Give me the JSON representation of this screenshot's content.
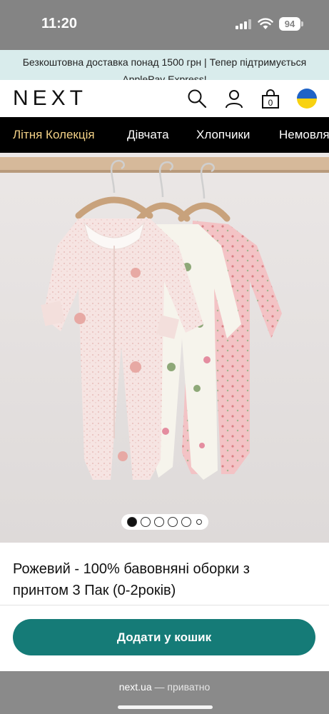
{
  "status_bar": {
    "time": "11:20",
    "battery": "94"
  },
  "promo": {
    "text": "Безкоштовна доставка понад 1500 грн | Тепер підтримується ApplePay Express!"
  },
  "header": {
    "logo": "NEXT",
    "icons": [
      "search-icon",
      "account-icon",
      "bag-icon",
      "ukraine-flag-icon"
    ],
    "bag_count": "0"
  },
  "nav": {
    "items": [
      "Літня Колекція",
      "Дівчата",
      "Хлопчики",
      "Немовлята"
    ]
  },
  "colors": {
    "accent_nav": "#f2d086",
    "cta": "#157b77",
    "promo_bg": "#d9ecec"
  },
  "product": {
    "image": "three-baby-sleepsuits-on-hangers",
    "title": "Рожевий - 100% бавовняні оборки з принтом 3 Пак (0-2років)",
    "gallery": {
      "count": 6,
      "current": 1
    }
  },
  "cta": {
    "label": "Додати у кошик"
  },
  "browser": {
    "domain": "next.ua",
    "separator": " — ",
    "mode": "приватно"
  }
}
